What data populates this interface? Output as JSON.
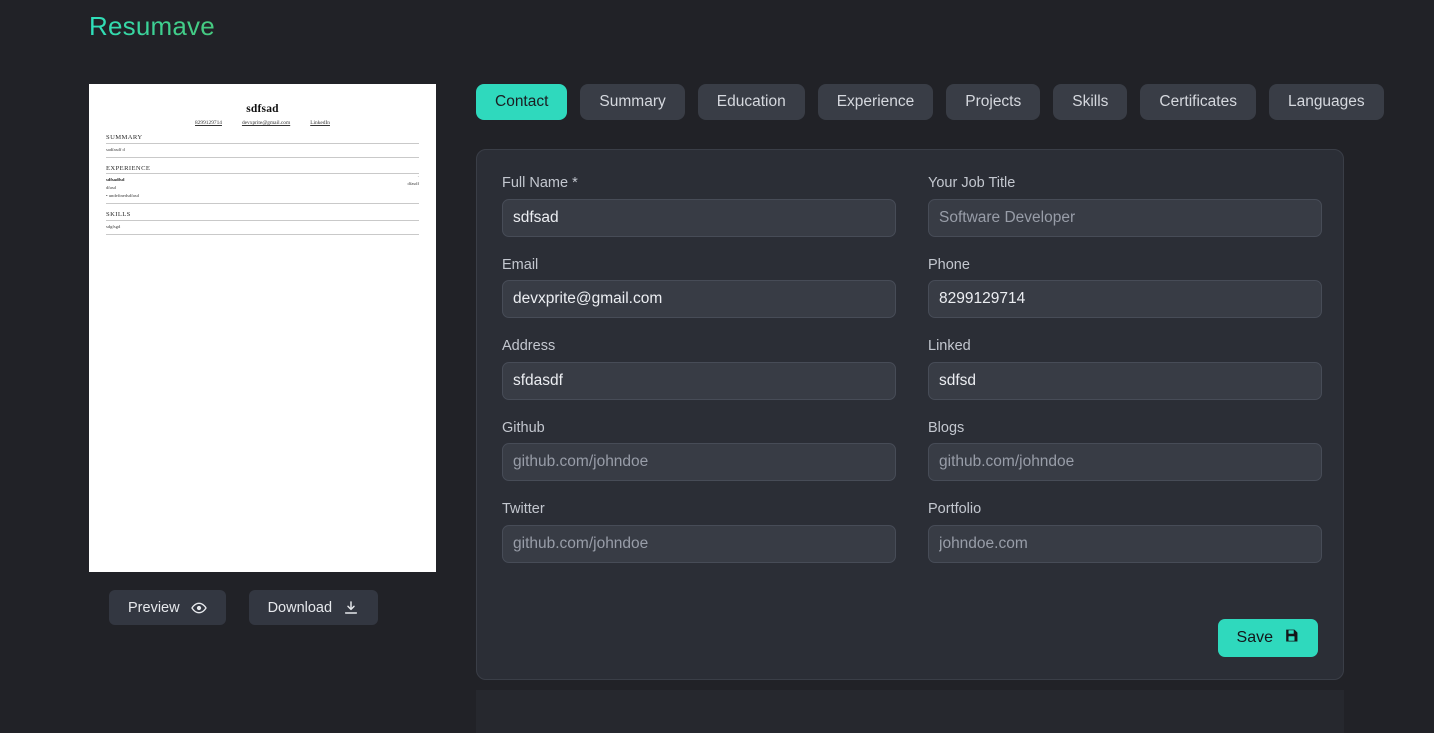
{
  "brand": {
    "name": "Resumave",
    "accent": "#2ee0bd"
  },
  "colors": {
    "page_bg": "#212227",
    "card_bg": "#2b2e36",
    "input_bg": "#383c45",
    "tab_bg": "#393d46",
    "accent": "#2fd9bd",
    "accent_text": "#1b1d22"
  },
  "resume_preview": {
    "name": "sdfsad",
    "links": [
      "8299129714",
      "devxprite@gmail.com",
      "LinkedIn"
    ],
    "sections": [
      {
        "title": "SUMMARY",
        "lines": [
          "sadfasdf d"
        ]
      },
      {
        "title": "EXPERIENCE",
        "role": "sdfsadfsd",
        "company": "dfasd",
        "date_dash": "-",
        "date": "dfasdf",
        "bullets": [
          "• undefinedsdfasd"
        ]
      },
      {
        "title": "SKILLS",
        "lines": [
          "sdgfsgd"
        ]
      }
    ]
  },
  "left_actions": {
    "preview_label": "Preview",
    "download_label": "Download"
  },
  "tabs": [
    {
      "label": "Contact",
      "active": true
    },
    {
      "label": "Summary",
      "active": false
    },
    {
      "label": "Education",
      "active": false
    },
    {
      "label": "Experience",
      "active": false
    },
    {
      "label": "Projects",
      "active": false
    },
    {
      "label": "Skills",
      "active": false
    },
    {
      "label": "Certificates",
      "active": false
    },
    {
      "label": "Languages",
      "active": false
    }
  ],
  "form": {
    "fields": [
      {
        "label": "Full Name *",
        "value": "sdfsad",
        "placeholder": ""
      },
      {
        "label": "Your Job Title",
        "value": "",
        "placeholder": "Software Developer"
      },
      {
        "label": "Email",
        "value": "devxprite@gmail.com",
        "placeholder": ""
      },
      {
        "label": "Phone",
        "value": "8299129714",
        "placeholder": ""
      },
      {
        "label": "Address",
        "value": "sfdasdf",
        "placeholder": ""
      },
      {
        "label": "Linked",
        "value": "sdfsd",
        "placeholder": ""
      },
      {
        "label": "Github",
        "value": "",
        "placeholder": "github.com/johndoe"
      },
      {
        "label": "Blogs",
        "value": "",
        "placeholder": "github.com/johndoe"
      },
      {
        "label": "Twitter",
        "value": "",
        "placeholder": "github.com/johndoe"
      },
      {
        "label": "Portfolio",
        "value": "",
        "placeholder": "johndoe.com"
      }
    ],
    "save_label": "Save"
  }
}
